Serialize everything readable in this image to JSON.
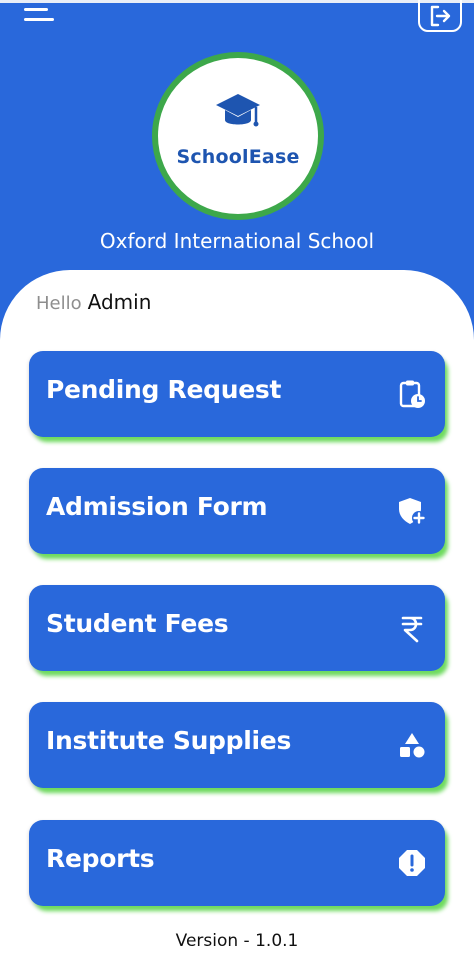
{
  "header": {
    "logo_text": "SchoolEase",
    "school_name": "Oxford International School",
    "menu_icon": "hamburger-menu-icon",
    "logout_icon": "logout-icon"
  },
  "greeting": {
    "hello": "Hello",
    "name": "Admin"
  },
  "menu": [
    {
      "label": "Pending Request",
      "icon": "clipboard-clock-icon"
    },
    {
      "label": "Admission Form",
      "icon": "shield-plus-icon"
    },
    {
      "label": "Student Fees",
      "icon": "rupee-icon"
    },
    {
      "label": "Institute Supplies",
      "icon": "shapes-icon"
    },
    {
      "label": "Reports",
      "icon": "alert-octagon-icon"
    }
  ],
  "footer": {
    "version": "Version - 1.0.1"
  },
  "colors": {
    "primary": "#2968db",
    "accent_green": "#3da84a",
    "card_glow": "#6edb5e",
    "logo_blue": "#1e55b0"
  }
}
